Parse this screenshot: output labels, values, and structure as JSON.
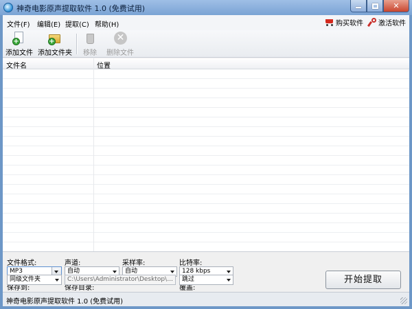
{
  "window": {
    "title": "神奇电影原声提取软件 1.0 (免费试用)"
  },
  "menu": {
    "items": [
      {
        "label": "文件(F)"
      },
      {
        "label": "编辑(E)"
      },
      {
        "label": "提取(C)"
      },
      {
        "label": "帮助(H)"
      }
    ],
    "buy_label": "购买软件",
    "activate_label": "激活软件"
  },
  "toolbar": {
    "add_file": "添加文件",
    "add_folder": "添加文件夹",
    "remove": "移除",
    "delete_file": "删除文件"
  },
  "filelist": {
    "columns": [
      "文件名",
      "位置"
    ]
  },
  "settings": {
    "format_label": "文件格式:",
    "format_value": "MP3",
    "channel_label": "声道:",
    "channel_value": "自动",
    "samplerate_label": "采样率:",
    "samplerate_value": "自动",
    "bitrate_label": "比特率:",
    "bitrate_value": "128 kbps",
    "saveto_label": "保存到:",
    "saveto_value": "同级文件夹",
    "savedir_label": "保存目录:",
    "savedir_value": "C:\\Users\\Administrator\\Desktop\\",
    "browse_label": "...",
    "overwrite_label": "覆盖:",
    "overwrite_value": "跳过",
    "start_label": "开始提取"
  },
  "status": {
    "text": "神奇电影原声提取软件 1.0 (免费试用)"
  },
  "colors": {
    "titlebar": "#7aa3d4",
    "close_button": "#c9452e",
    "add_badge": "#3aa83a"
  }
}
